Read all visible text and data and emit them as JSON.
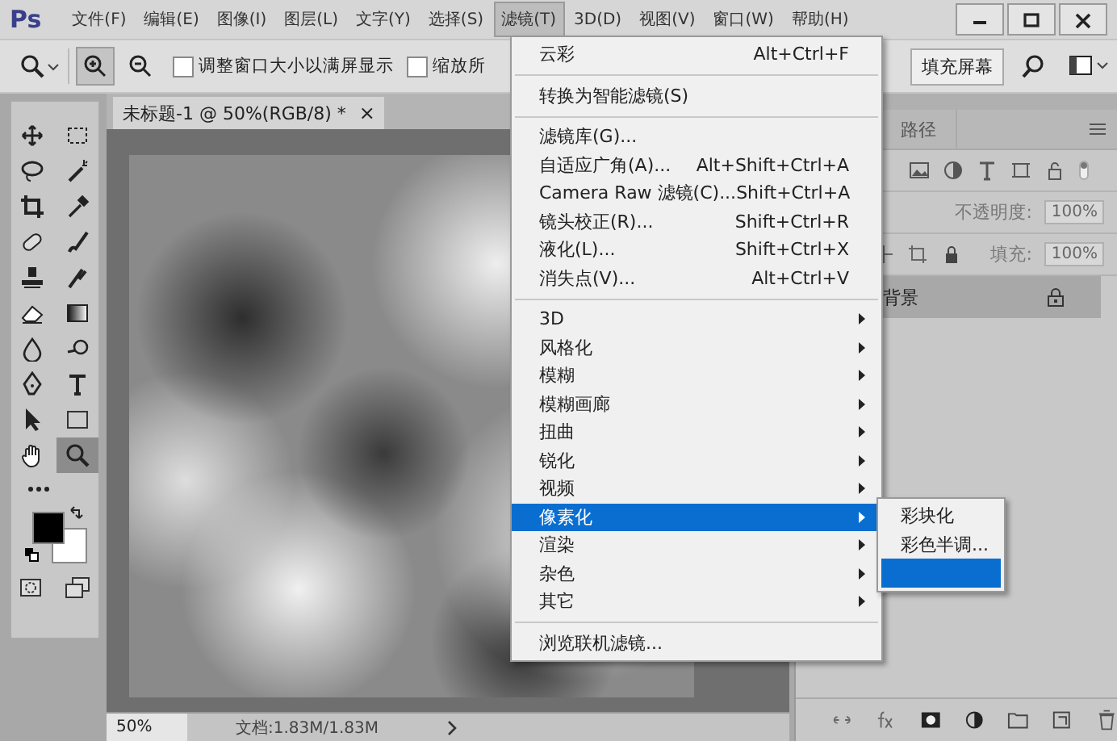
{
  "app": {
    "logo": "Ps"
  },
  "menubar": [
    {
      "label": "文件(F)",
      "selected": false
    },
    {
      "label": "编辑(E)",
      "selected": false
    },
    {
      "label": "图像(I)",
      "selected": false
    },
    {
      "label": "图层(L)",
      "selected": false
    },
    {
      "label": "文字(Y)",
      "selected": false
    },
    {
      "label": "选择(S)",
      "selected": false
    },
    {
      "label": "滤镜(T)",
      "selected": true
    },
    {
      "label": "3D(D)",
      "selected": false
    },
    {
      "label": "视图(V)",
      "selected": false
    },
    {
      "label": "窗口(W)",
      "selected": false
    },
    {
      "label": "帮助(H)",
      "selected": false
    }
  ],
  "options_bar": {
    "zoom_in_selected": true,
    "checkboxes": [
      {
        "label": "调整窗口大小以满屏显示",
        "checked": false
      },
      {
        "label": "缩放所",
        "checked": false
      }
    ],
    "fill_button": "填充屏幕"
  },
  "document_tab": {
    "title": "未标题-1 @ 50%(RGB/8) *",
    "close": "×"
  },
  "tools": [
    {
      "kind": "move",
      "selected": false
    },
    {
      "kind": "marquee",
      "selected": false
    },
    {
      "kind": "lasso",
      "selected": false
    },
    {
      "kind": "wand",
      "selected": false
    },
    {
      "kind": "crop",
      "selected": false
    },
    {
      "kind": "eyedropper",
      "selected": false
    },
    {
      "kind": "bandage",
      "selected": false
    },
    {
      "kind": "brush",
      "selected": false
    },
    {
      "kind": "stamp",
      "selected": false
    },
    {
      "kind": "history",
      "selected": false
    },
    {
      "kind": "eraser",
      "selected": false
    },
    {
      "kind": "gradient",
      "selected": false
    },
    {
      "kind": "blur",
      "selected": false
    },
    {
      "kind": "dodge",
      "selected": false
    },
    {
      "kind": "pen",
      "selected": false
    },
    {
      "kind": "type",
      "selected": false
    },
    {
      "kind": "arrow",
      "selected": false
    },
    {
      "kind": "rect",
      "selected": false
    },
    {
      "kind": "hand",
      "selected": false
    },
    {
      "kind": "zoom",
      "selected": true
    }
  ],
  "status_bar": {
    "zoom": "50%",
    "doc_size": "文档:1.83M/1.83M"
  },
  "layers_panel": {
    "tabs": [
      {
        "label": "路径",
        "selected": false
      }
    ],
    "opacity_label": "不透明度:",
    "opacity": "100%",
    "fill_label": "填充:",
    "fill": "100%",
    "layers": [
      {
        "name": "背景",
        "selected": true,
        "locked": true
      }
    ]
  },
  "filter_menu": {
    "items": [
      {
        "kind": "item",
        "label": "云彩",
        "shortcut": "Alt+Ctrl+F"
      },
      {
        "kind": "separator"
      },
      {
        "kind": "item",
        "label": "转换为智能滤镜(S)"
      },
      {
        "kind": "separator"
      },
      {
        "kind": "item",
        "label": "滤镜库(G)..."
      },
      {
        "kind": "item",
        "label": "自适应广角(A)...",
        "shortcut": "Alt+Shift+Ctrl+A"
      },
      {
        "kind": "item",
        "label": "Camera Raw 滤镜(C)...",
        "shortcut": "Shift+Ctrl+A"
      },
      {
        "kind": "item",
        "label": "镜头校正(R)...",
        "shortcut": "Shift+Ctrl+R"
      },
      {
        "kind": "item",
        "label": "液化(L)...",
        "shortcut": "Shift+Ctrl+X"
      },
      {
        "kind": "item",
        "label": "消失点(V)...",
        "shortcut": "Alt+Ctrl+V"
      },
      {
        "kind": "separator"
      },
      {
        "kind": "submenu",
        "label": "3D",
        "selected": false
      },
      {
        "kind": "submenu",
        "label": "风格化",
        "selected": false
      },
      {
        "kind": "submenu",
        "label": "模糊",
        "selected": false
      },
      {
        "kind": "submenu",
        "label": "模糊画廊",
        "selected": false
      },
      {
        "kind": "submenu",
        "label": "扭曲",
        "selected": false
      },
      {
        "kind": "submenu",
        "label": "锐化",
        "selected": false
      },
      {
        "kind": "submenu",
        "label": "视频",
        "selected": false
      },
      {
        "kind": "submenu",
        "label": "像素化",
        "selected": true
      },
      {
        "kind": "submenu",
        "label": "渲染",
        "selected": false
      },
      {
        "kind": "submenu",
        "label": "杂色",
        "selected": false
      },
      {
        "kind": "submenu",
        "label": "其它",
        "selected": false
      },
      {
        "kind": "separator"
      },
      {
        "kind": "item",
        "label": "浏览联机滤镜..."
      }
    ]
  },
  "pixelate_submenu": {
    "items": [
      {
        "label": "彩块化",
        "selected": false
      },
      {
        "label": "彩色半调...",
        "selected": false
      },
      {
        "selected": true
      }
    ]
  }
}
